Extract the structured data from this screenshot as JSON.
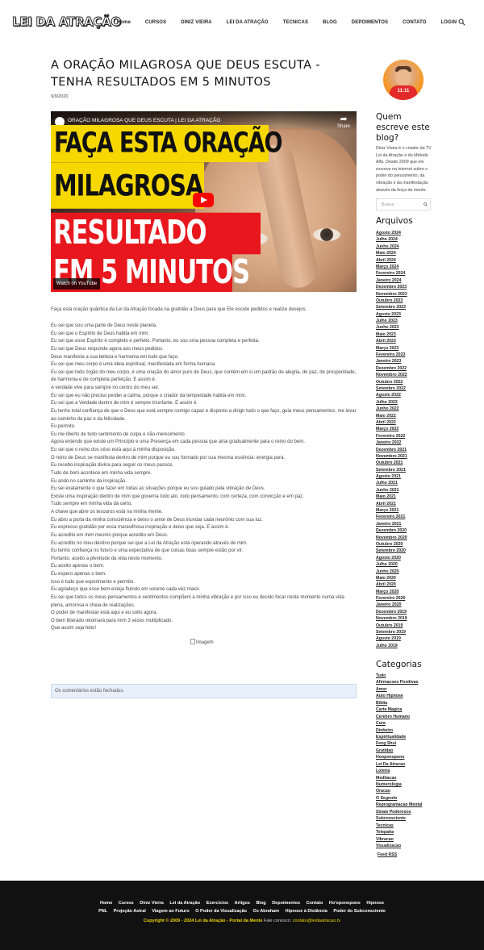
{
  "site": {
    "logo_text": "LEI DA ATRAÇÃO",
    "nav": [
      "Home",
      "CURSOS",
      "DINIZ VIEIRA",
      "LEI DA ATRAÇÃO",
      "TECNICAS",
      "BLOG",
      "DEPOIMENTOS",
      "CONTATO",
      "LOGIN"
    ],
    "search_icon": "search-icon"
  },
  "post": {
    "title": "A ORAÇÃO MILAGROSA QUE DEUS ESCUTA - TENHA RESULTADOS EM 5 MINUTOS",
    "date": "9/9/2020",
    "video": {
      "title": "ORAÇÃO MILAGROSA QUE DEUS ESCUTA | LEI DA ATRAÇÃO",
      "share_label": "Share",
      "line1": "FAÇA ESTA ORAÇÃO",
      "line2": "MILAGROSA",
      "line3": "RESULTADO",
      "line4": "EM 5 MINUTOS",
      "watch_label": "Watch on  YouTube"
    },
    "intro": "Faça esta oração quântica da Lei da Atração focada na gratidão a Deus para que Ele escute pedidos e realize desejos.",
    "body": [
      "Eu sei que sou uma parte de Deus neste planeta.",
      "Eu sei que o Espírito de Deus habita em mim.",
      "Eu sei que esse Espírito é completo e perfeito. Portanto, eu sou uma pessoa completa e perfeita.",
      "Eu sei que Deus responde agora aos meus pedidos.",
      "Deus manifesta a sua beleza e harmonia em tudo que faço.",
      "Eu sei que meu corpo é uma ideia espiritual, manifestada em forma humana.",
      "Eu sei que todo órgão do meu corpo, é uma criação do amor puro de Deus, que contém em si um padrão de alegria, de paz, de prosperidade, de harmonia e de completa perfeição. E assim é.",
      "A verdade vive para sempre no centro do meu ser.",
      "Eu sei que eu não preciso perder a calma, porque o criador da tempestade habita em mim.",
      "Eu sei que a Verdade dentro de mim é sempre triunfante. E assim é.",
      "Eu tenho total confiança de que o Deus que está sempre comigo capaz e disposto a dirigir tudo o que faço, guia meus pensamentos, me levar ao caminho da paz e da felicidade.",
      "Eu permito.",
      "Eu me liberto de todo sentimento de culpa e não-merecimento.",
      "Agora entendo que existe um Princípio e uma Presença em cada pessoa que atrai gradualmente para o reino do bem.",
      "Eu sei que o reino dos céus está aqui à minha disposição.",
      "O reino de Deus se manifesta dentro de mim porque eu sou formado por sua mesma essência: energia pura.",
      "Eu recebo inspiração divina para seguir os meus passos.",
      "Tudo de bom acontece em minha vida sempre.",
      "Eu ando no caminho da inspiração.",
      "Eu sei exatamente o que fazer em todas as situações porque eu sou guiado pela vibração de Deus.",
      "Existe uma inspiração dentro de mim que governa todo ato, todo pensamento, com certeza, com convicção e em paz.",
      "Tudo sempre em minha vida dá certo.",
      "A chave que abre os tesouros está na minha mente.",
      "Eu abro a porta da minha consciência e deixo o amor de Deus inundar cada neurônio com sua luz.",
      "Eu expresso gratidão por essa maravilhosa inspiração e deixo que seja. E assim é.",
      "Eu acredito em mim mesmo porque acredito em Deus.",
      "Eu acredito no meu destino porque sei que a Lei da Atração está operando através de mim.",
      "Eu tenho confiança no futuro e uma expectativa de que coisas boas sempre estão por vir.",
      "Portanto, aceito a plenitude da vida neste momento.",
      "Eu aceito apenas o bem.",
      "Eu espero apenas o bem.",
      "Isso é tudo que experimento e permito.",
      "Eu agradeço que esse bem esteja fluindo em volume cada vez maior.",
      "Eu sei que todos os meus pensamentos e sentimentos compõem a minha vibração e por isso eu decido focar neste momento numa vida plena, amorosa e cheia de realizações.",
      "O poder de manifestar está aqui e eu solto agora.",
      "O bem liberado retornará para mim 3 vezes multiplicado.",
      "Que assim seja feito!"
    ],
    "image_alt": "Imagem",
    "comments_closed": "Os comentários estão fechados."
  },
  "sidebar": {
    "avatar_shirt_text": "11:11",
    "about_title": "Quem escreve este blog?",
    "about_text": "Diniz Vieira é o criador da TV Lei da Atração e do Método Alfa. Desde 2009 que ele escreve na internet sobre o poder do pensamento, da vibração e da manifestação através da força da mente.",
    "search_placeholder": "Busca",
    "archives_title": "Arquivos",
    "archives": [
      "Agosto 2024",
      "Julho 2024",
      "Junho 2024",
      "Maio 2024",
      "Abril 2024",
      "Março 2024",
      "Fevereiro 2024",
      "Janeiro 2024",
      "Dezembro 2023",
      "Novembro 2023",
      "Outubro 2023",
      "Setembro 2023",
      "Agosto 2023",
      "Julho 2023",
      "Junho 2023",
      "Maio 2023",
      "Abril 2023",
      "Março 2023",
      "Fevereiro 2023",
      "Janeiro 2023",
      "Dezembro 2022",
      "Novembro 2022",
      "Outubro 2022",
      "Setembro 2022",
      "Agosto 2022",
      "Julho 2022",
      "Junho 2022",
      "Maio 2022",
      "Abril 2022",
      "Março 2022",
      "Fevereiro 2022",
      "Janeiro 2022",
      "Dezembro 2021",
      "Novembro 2021",
      "Outubro 2021",
      "Setembro 2021",
      "Agosto 2021",
      "Julho 2021",
      "Junho 2021",
      "Maio 2021",
      "Abril 2021",
      "Março 2021",
      "Fevereiro 2021",
      "Janeiro 2021",
      "Dezembro 2020",
      "Novembro 2020",
      "Outubro 2020",
      "Setembro 2020",
      "Agosto 2020",
      "Julho 2020",
      "Junho 2020",
      "Maio 2020",
      "Abril 2020",
      "Março 2020",
      "Fevereiro 2020",
      "Janeiro 2020",
      "Dezembro 2019",
      "Novembro 2019",
      "Outubro 2019",
      "Setembro 2019",
      "Agosto 2019",
      "Julho 2019",
      "Junho 2019"
    ],
    "categories_title": "Categorias",
    "categories": [
      "Tudo",
      "Afirmacoes Positivas",
      "Amor",
      "Auto Hipnose",
      "Bíblia",
      "Carta Magica",
      "Cerebro Humano",
      "Cura",
      "Dinheiro",
      "Espiritualidade",
      "Feng Shui",
      "Gratidao",
      "Hooponopono",
      "Lei Da Atracao",
      "Loteria",
      "Meditacao",
      "Numerologia",
      "Oracao",
      "O Segredo",
      "Reprogramacao Mental",
      "Sinais Poderosos",
      "Subconsciente",
      "Tecnicas",
      "Telepatia",
      "Vibracao",
      "Visualizacao"
    ],
    "feed_rss": "Feed RSS"
  },
  "footer": {
    "nav_row1": [
      "Home",
      "Cursos",
      "Diniz Vieira",
      "Lei da Atração",
      "Exercícios",
      "Artigos",
      "Blog",
      "Depoimentos",
      "Contato",
      "Ho'oponopono",
      "Hipnose"
    ],
    "nav_row2": [
      "PNL",
      "Projeção Astral",
      "Viagem ao Futuro",
      "O Poder da Visualização",
      "Os Abraham",
      "Hipnose à Distância",
      "Poder do Subconsciente"
    ],
    "copyright": "Copyright © 2009 - 2024 Lei da Atração - Portal da Mente",
    "contact_label": "Fale conosco:",
    "contact_email": "contato@leidaatracao.tv"
  },
  "colors": {
    "footer_bg": "#111111",
    "footer_accent": "#f1d500",
    "comment_box_bg": "#e7f0fa",
    "video_yellow": "#f6d800",
    "video_red": "#e8171d"
  }
}
